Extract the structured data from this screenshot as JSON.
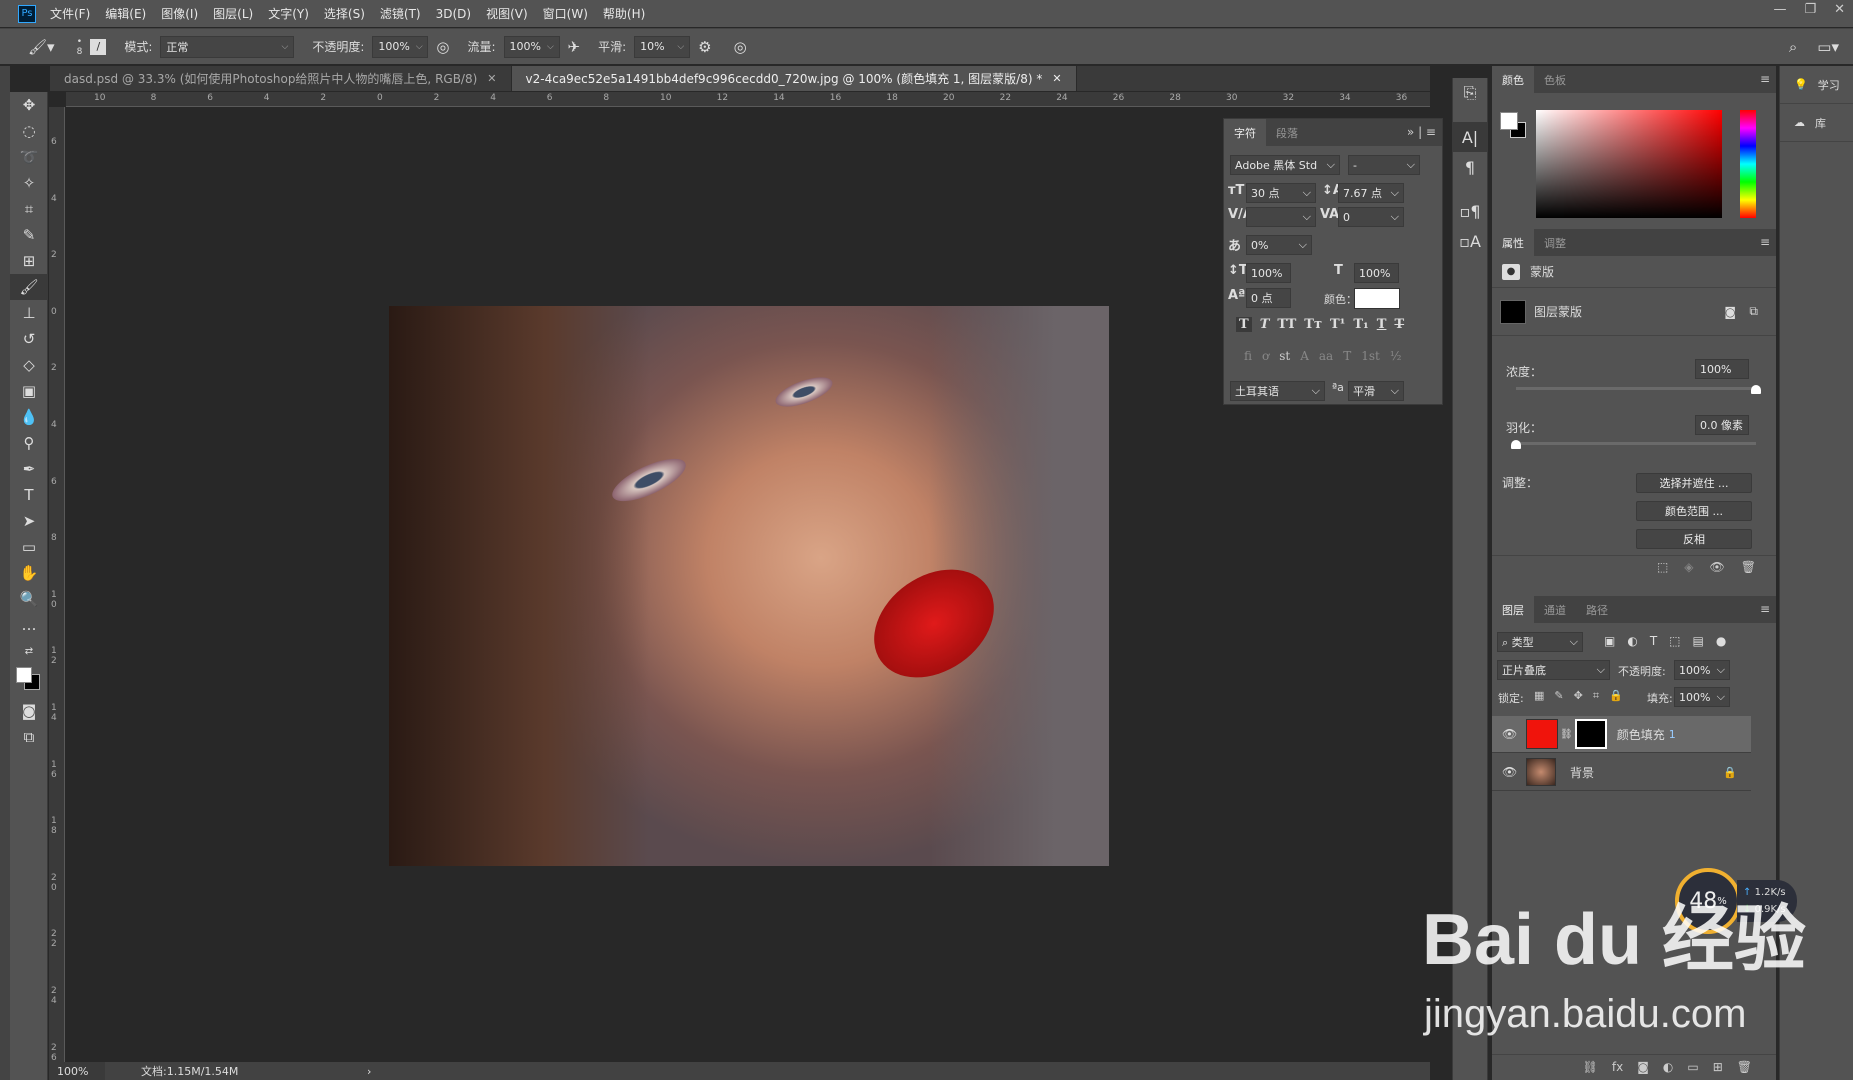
{
  "app": {
    "logo": "Ps"
  },
  "menu": [
    "文件(F)",
    "编辑(E)",
    "图像(I)",
    "图层(L)",
    "文字(Y)",
    "选择(S)",
    "滤镜(T)",
    "3D(D)",
    "视图(V)",
    "窗口(W)",
    "帮助(H)"
  ],
  "window_controls": [
    "—",
    "❐",
    "✕"
  ],
  "options": {
    "brush_size": "8",
    "mode_label": "模式:",
    "mode_value": "正常",
    "opacity_label": "不透明度:",
    "opacity_value": "100%",
    "flow_label": "流量:",
    "flow_value": "100%",
    "smooth_label": "平滑:",
    "smooth_value": "10%"
  },
  "tabs": [
    {
      "label": "dasd.psd @ 33.3% (如何使用Photoshop给照片中人物的嘴唇上色, RGB/8)",
      "active": false
    },
    {
      "label": "v2-4ca9ec52e5a1491bb4def9c996cecdd0_720w.jpg @ 100% (颜色填充 1, 图层蒙版/8) *",
      "active": true
    }
  ],
  "ruler_top": [
    "10",
    "8",
    "6",
    "4",
    "2",
    "0",
    "2",
    "4",
    "6",
    "8",
    "10",
    "12",
    "14",
    "16",
    "18",
    "20",
    "22",
    "24",
    "26",
    "28",
    "30",
    "32",
    "34",
    "36"
  ],
  "ruler_left": [
    "6",
    "4",
    "2",
    "0",
    "2",
    "4",
    "6",
    "8",
    "1 0",
    "1 2",
    "1 4",
    "1 6",
    "1 8",
    "2 0",
    "2 2",
    "2 4",
    "2 6"
  ],
  "status": {
    "zoom": "100%",
    "doc": "文档:1.15M/1.54M",
    "arrow": "›"
  },
  "character": {
    "tabs": [
      "字符",
      "段落"
    ],
    "font": "Adobe 黑体 Std",
    "style": "-",
    "size": "30 点",
    "leading": "7.67 点",
    "kerning": "",
    "tracking": "0",
    "tsume": "0%",
    "vscale": "100%",
    "hscale": "100%",
    "baseline": "0 点",
    "color_label": "颜色：",
    "style_buttons": [
      "T",
      "T",
      "TT",
      "Tт",
      "T¹",
      "T₁",
      "T",
      "T"
    ],
    "ot_buttons": [
      "fi",
      "ơ",
      "st",
      "A",
      "aa",
      "T",
      "1st",
      "½"
    ],
    "language": "土耳其语",
    "aa_icon": "ªa",
    "antialias": "平滑"
  },
  "color_panel": {
    "tabs": [
      "颜色",
      "色板"
    ],
    "hue_color": "#ff0000"
  },
  "properties": {
    "tabs": [
      "属性",
      "调整"
    ],
    "section": "蒙版",
    "mask_label": "图层蒙版",
    "density_label": "浓度：",
    "density_value": "100%",
    "density": 1.0,
    "feather_label": "羽化：",
    "feather_value": "0.0 像素",
    "feather": 0.0,
    "adjust_label": "调整：",
    "buttons": [
      "选择并遮住 ...",
      "颜色范围 ...",
      "反相"
    ]
  },
  "layers": {
    "tabs": [
      "图层",
      "通道",
      "路径"
    ],
    "filter": "类型",
    "blend": "正片叠底",
    "opacity_label": "不透明度:",
    "opacity": "100%",
    "lock_label": "锁定:",
    "fill_label": "填充:",
    "fill": "100%",
    "items": [
      {
        "name": "颜色填充",
        "suffix": "1",
        "color": "#f0140c",
        "selected": true
      },
      {
        "name": "背景",
        "suffix": "",
        "locked": true
      }
    ]
  },
  "far_right": [
    {
      "label": "学习"
    },
    {
      "label": "库"
    }
  ],
  "network": {
    "percent": "48",
    "unit": "%",
    "up": "1.2",
    "down": "0.9",
    "rate_unit": "K/s"
  },
  "watermark": {
    "brand": "Bai du 经验",
    "url": "jingyan.baidu.com"
  }
}
